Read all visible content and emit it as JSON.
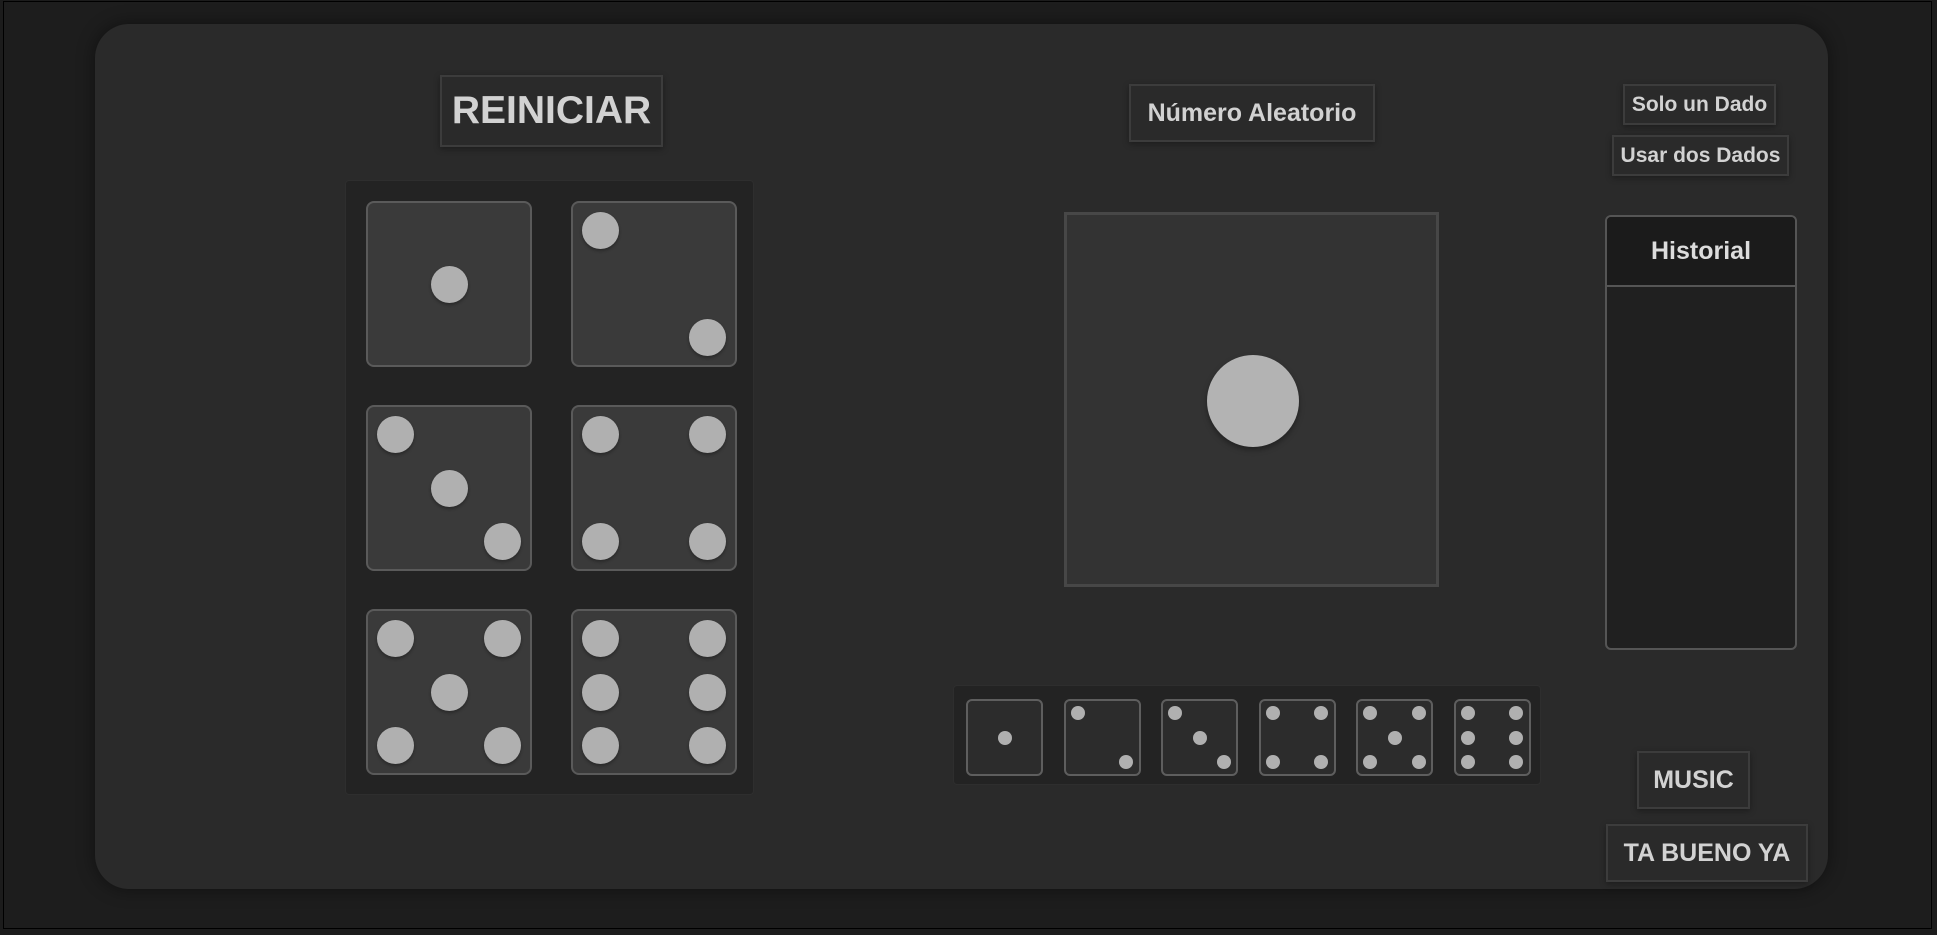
{
  "buttons": {
    "reiniciar": "REINICIAR",
    "numero_aleatorio": "Número Aleatorio",
    "solo_un_dado": "Solo un Dado",
    "usar_dos_dados": "Usar dos Dados",
    "music": "MUSIC",
    "ta_bueno_ya": "TA BUENO YA"
  },
  "dice_selector": [
    1,
    2,
    3,
    4,
    5,
    6
  ],
  "current_roll": 1,
  "dice_strip": [
    1,
    2,
    3,
    4,
    5,
    6
  ],
  "historial": {
    "title": "Historial",
    "entries": []
  },
  "colors": {
    "panel": "#2a2a2a",
    "die_face": "#3a3a3a",
    "pip": "#b0b0b0",
    "text": "#d2d2d2"
  }
}
